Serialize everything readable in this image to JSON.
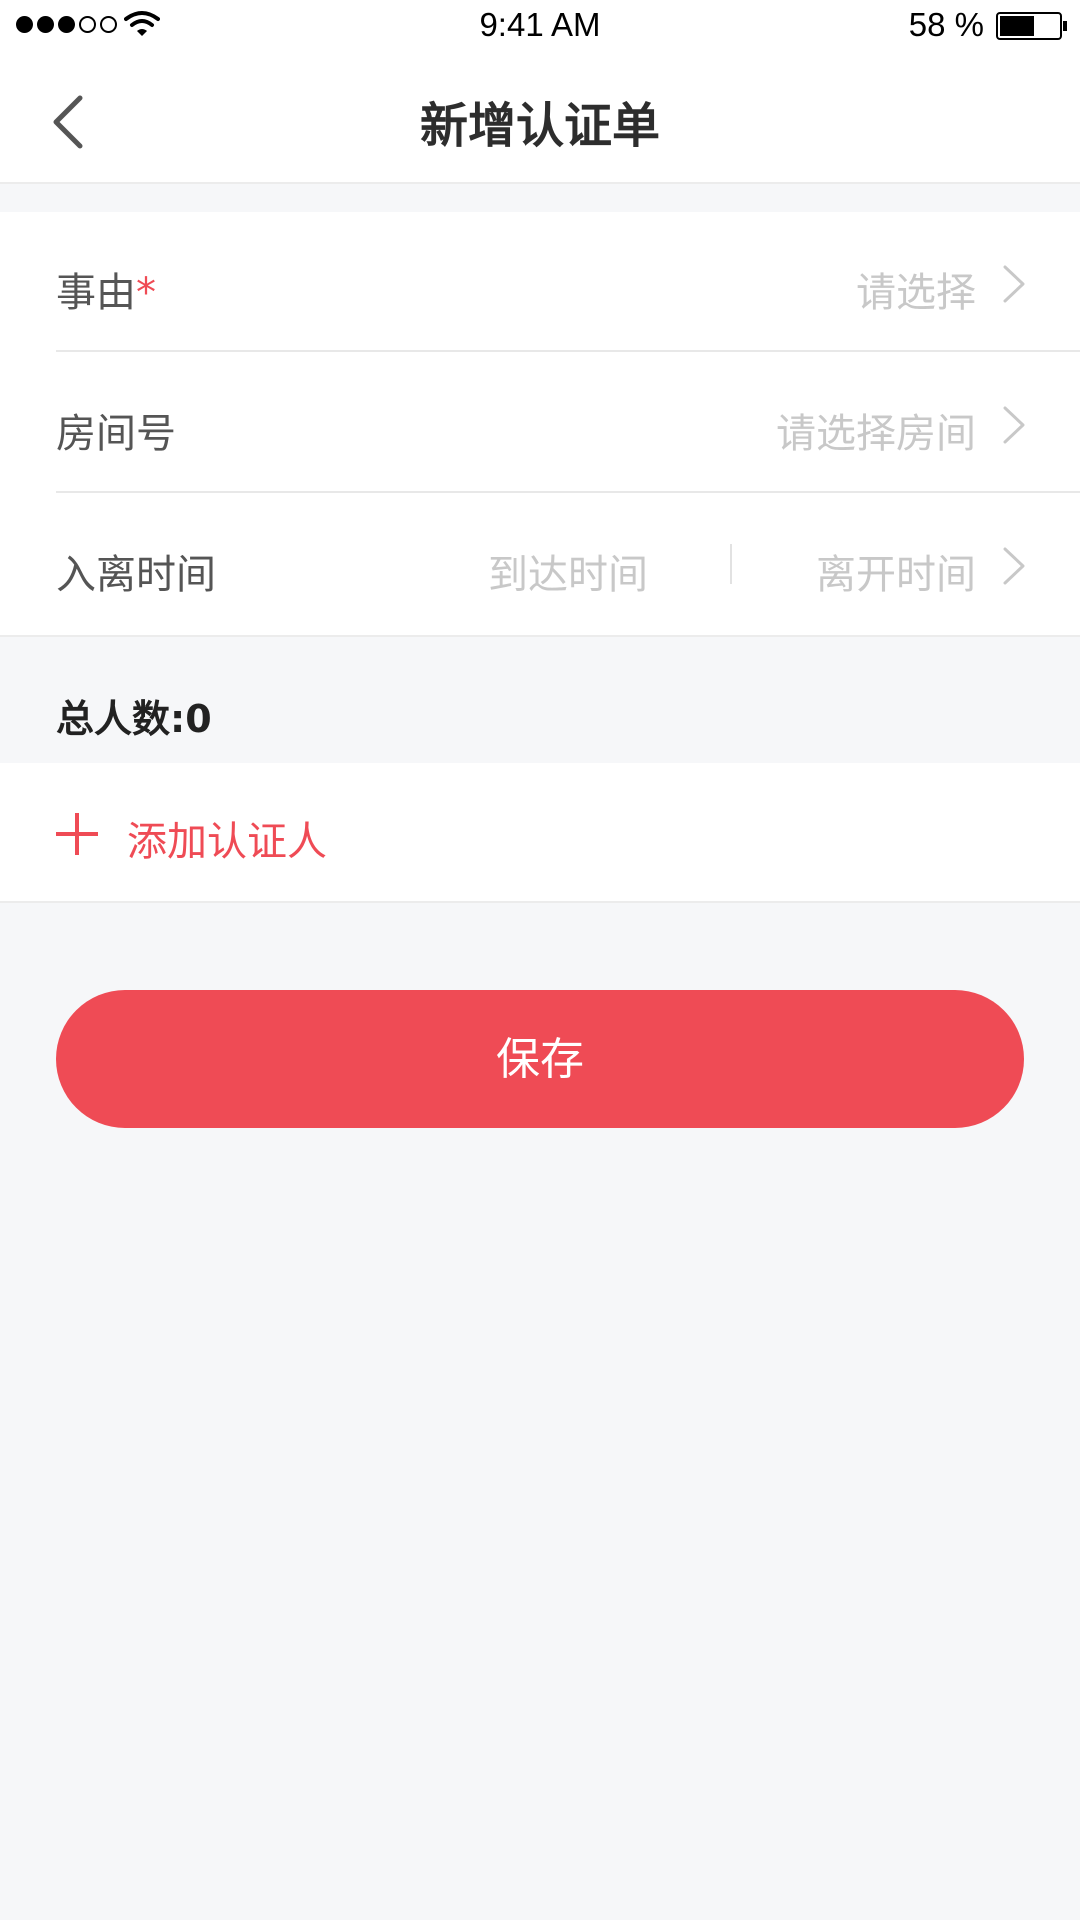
{
  "status_bar": {
    "time": "9:41 AM",
    "battery_percent": "58 %",
    "signal_bars_filled": 3,
    "signal_bars_total": 5,
    "battery_level": 0.58
  },
  "nav": {
    "title": "新增认证单"
  },
  "form": {
    "reason": {
      "label": "事由",
      "required_mark": "*",
      "placeholder": "请选择"
    },
    "room": {
      "label": "房间号",
      "placeholder": "请选择房间"
    },
    "stay_time": {
      "label": "入离时间",
      "arrival_placeholder": "到达时间",
      "departure_placeholder": "离开时间"
    }
  },
  "total": {
    "text": "总人数:0"
  },
  "add_person": {
    "label": "添加认证人"
  },
  "save_button": {
    "label": "保存"
  },
  "colors": {
    "accent": "#ef4b55",
    "background": "#f6f7f9",
    "placeholder": "#c8c8c8"
  }
}
